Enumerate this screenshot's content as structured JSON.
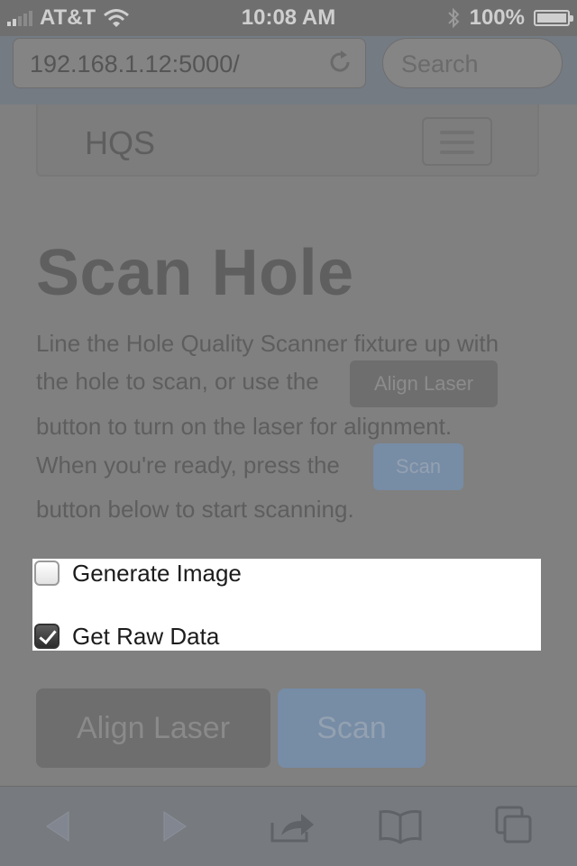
{
  "status_bar": {
    "carrier": "AT&T",
    "time": "10:08 AM",
    "battery": "100%",
    "icons": [
      "signal-bars-icon",
      "wifi-icon",
      "bluetooth-icon",
      "battery-icon"
    ]
  },
  "browser": {
    "url": "192.168.1.12:5000/",
    "search_placeholder": "Search"
  },
  "navbar": {
    "brand": "HQS"
  },
  "page": {
    "title": "Scan Hole",
    "para_line1": "Line the Hole Quality Scanner fixture up with",
    "para_line2_prefix": "the hole to scan, or use the",
    "inline_align_label": "Align Laser",
    "para_line3": "button to turn on the laser for alignment.",
    "para_line4_prefix": "When you're ready, press the",
    "inline_scan_label": "Scan",
    "para_line5": "button below to start scanning."
  },
  "options": {
    "generate_image_label": "Generate Image",
    "generate_image_checked": false,
    "get_raw_data_label": "Get Raw Data",
    "get_raw_data_checked": true
  },
  "actions": {
    "align_label": "Align Laser",
    "scan_label": "Scan"
  },
  "colors": {
    "overlay": "#808080",
    "primary_button": "#778ca5",
    "default_button": "#6e6e6e"
  }
}
